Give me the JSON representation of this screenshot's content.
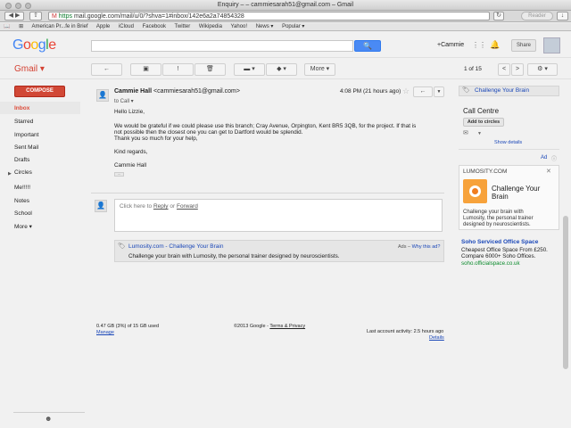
{
  "window": {
    "title": "Enquiry – – cammiesarah51@gmail.com – Gmail"
  },
  "browser": {
    "url_scheme": "https",
    "url": "mail.google.com/mail/u/0/?shva=1#inbox/142e6a2a74854328",
    "reader_label": "Reader",
    "bookmarks": [
      "American Pr...fe in Brief",
      "Apple",
      "iCloud",
      "Facebook",
      "Twitter",
      "Wikipedia",
      "Yahoo!",
      "News ▾",
      "Popular ▾"
    ]
  },
  "header": {
    "logo": "Google",
    "search_button": "🔍",
    "plus_user": "+Cammie",
    "share_label": "Share"
  },
  "toolbar": {
    "app_label": "Gmail ▾",
    "back_label": "←",
    "archive_label": "▣",
    "spam_label": "!",
    "delete_label": "🗑",
    "move_label": "▬ ▾",
    "labels_label": "◆ ▾",
    "more_label": "More ▾",
    "pager": "1 of 15",
    "prev_label": "<",
    "next_label": ">",
    "settings_label": "⚙ ▾"
  },
  "sidebar": {
    "compose": "COMPOSE",
    "items": [
      "Inbox",
      "Starred",
      "Important",
      "Sent Mail",
      "Drafts",
      "Circles",
      "Me!!!!!",
      "Notes",
      "School",
      "More ▾"
    ]
  },
  "message": {
    "sender_name": "Cammie Hall",
    "sender_email": "<cammiesarah51@gmail.com>",
    "to_line": "to Call ▾",
    "date": "4:08 PM (21 hours ago)",
    "body": [
      "Hello Lizzie,",
      "We would be grateful if we could please use this branch; Cray Avenue, Orpington, Kent BR5 3QB, for the project. If that is",
      "not possible then the closest one you can get to Dartford would be splendid.",
      "Thank you so much for your help,",
      "Kind regards,",
      "Cammie Hall"
    ],
    "ellipsis": "···"
  },
  "reply": {
    "prefix": "Click here to ",
    "reply_link": "Reply",
    "middle": " or ",
    "forward_link": "Forward"
  },
  "bottom_ad": {
    "title": "Lumosity.com - Challenge Your Brain",
    "body": "Challenge your brain with Lumosity, the personal trainer designed by neuroscientists.",
    "ads_prefix": "Ads – ",
    "ads_link": "Why this ad?"
  },
  "footer": {
    "storage": "0.47 GB (3%) of 15 GB used",
    "manage": "Manage",
    "copyright": "©2013 Google - ",
    "terms": "Terms & Privacy",
    "last_activity": "Last account activity: 2.5 hours ago",
    "details": "Details"
  },
  "right_panel": {
    "tag_label": "Challenge Your Brain",
    "contact_name": "Call Centre",
    "add_to_circles": "Add to circles",
    "show_details": "Show details",
    "ad_label": "Ad",
    "lumo_url": "LUMOSITY.COM",
    "lumo_title_1": "Challenge Your",
    "lumo_title_2": "Brain",
    "lumo_desc": [
      "Challenge your brain with",
      "Lumosity, the personal trainer",
      "designed by neuroscientists."
    ],
    "soho_title": "Soho Serviced Office Space",
    "soho_lines": [
      "Cheapest Office Space From £250.",
      "Compare 6000+ Soho Offices."
    ],
    "soho_url": "soho.officialspace.co.uk"
  }
}
